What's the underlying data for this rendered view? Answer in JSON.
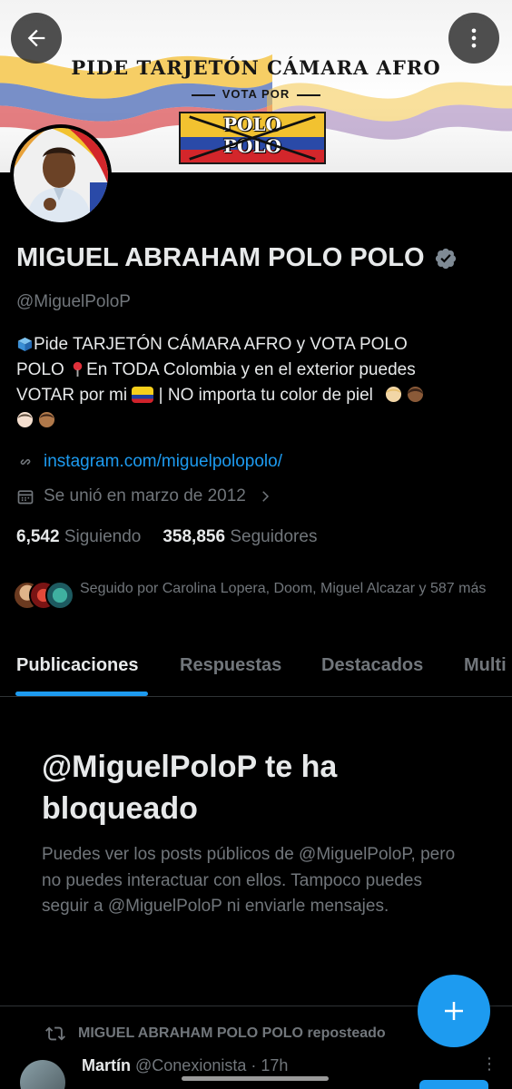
{
  "banner": {
    "title": "Pide tarjetón cámara afro",
    "subtitle": "VOTA POR",
    "logo_line1": "POLO",
    "logo_line2": "POLO"
  },
  "nav": {
    "back_icon": "arrow-left-icon",
    "more_icon": "more-vertical-icon"
  },
  "profile": {
    "display_name": "MIGUEL ABRAHAM POLO POLO",
    "handle": "@MiguelPoloP",
    "bio": {
      "line1": "Pide TARJETÓN CÁMARA AFRO y VOTA POLO",
      "line2": "POLO",
      "line2b": "En TODA Colombia y en el exterior puedes",
      "line3": "VOTAR por mi",
      "line3b": "| NO importa tu color de piel"
    },
    "link": "instagram.com/miguelpolopolo/",
    "joined": "Se unió en marzo de 2012",
    "following_count": "6,542",
    "following_label": "Siguiendo",
    "followers_count": "358,856",
    "followers_label": "Seguidores",
    "followed_by": "Seguido por Carolina Lopera, Doom, Miguel Alcazar y 587 más"
  },
  "tabs": [
    {
      "label": "Publicaciones",
      "active": true
    },
    {
      "label": "Respuestas",
      "active": false
    },
    {
      "label": "Destacados",
      "active": false
    },
    {
      "label": "Multi",
      "active": false
    }
  ],
  "blocked": {
    "title": "@MiguelPoloP te ha bloqueado",
    "description": "Puedes ver los posts públicos de @MiguelPoloP, pero no puedes interactuar con ellos. Tampoco puedes seguir a @MiguelPoloP ni enviarle mensajes."
  },
  "repost": {
    "label": "MIGUEL ABRAHAM POLO POLO reposteado",
    "author_name": "Martín",
    "author_handle": "@Conexionista",
    "time": "· 17h"
  },
  "colors": {
    "accent": "#1d9bf0",
    "background": "#000000",
    "muted": "#71767b",
    "text": "#e7e9ea"
  }
}
